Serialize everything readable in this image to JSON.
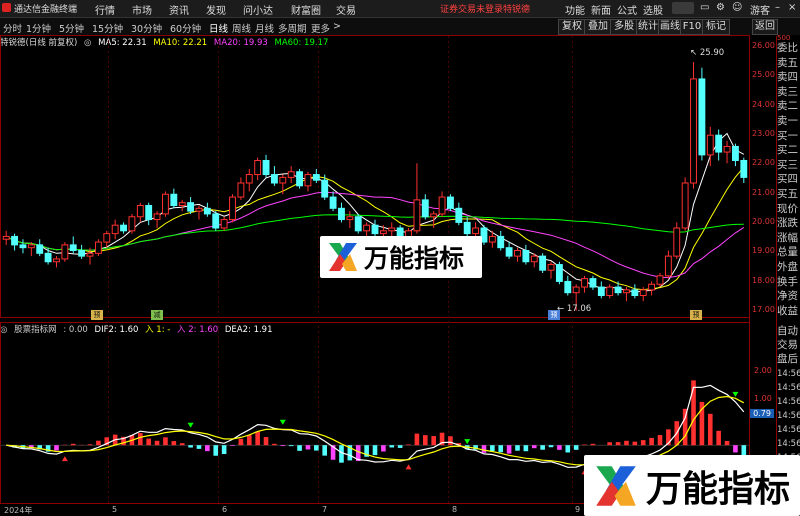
{
  "app": {
    "title": "通达信金融终端",
    "menu": [
      "行情",
      "市场",
      "资讯",
      "发现",
      "问小达",
      "财富圈",
      "交易"
    ],
    "login_status": "证券交易未登录",
    "stock_tag": "特锐德",
    "right_menu": [
      "功能",
      "新面",
      "公式",
      "选股"
    ],
    "user": "游客"
  },
  "toolbar": {
    "periods": [
      "分时",
      "1分钟",
      "5分钟",
      "15分钟",
      "30分钟",
      "60分钟",
      "日线",
      "周线",
      "月线",
      "多周期",
      "更多"
    ],
    "active_period": "日线",
    "buttons": [
      "复权",
      "叠加",
      "多股",
      "统计",
      "画线",
      "F10",
      "标记",
      "返回"
    ],
    "period_arrow": ">"
  },
  "main_chart": {
    "stock_label": "特锐德(日线 前复权)",
    "ma": [
      {
        "label": "MA5: 22.31",
        "color": "#ffffff"
      },
      {
        "label": "MA10: 22.21",
        "color": "#ffff00"
      },
      {
        "label": "MA20: 19.93",
        "color": "#ff44ff"
      },
      {
        "label": "MA60: 19.17",
        "color": "#00ff00"
      }
    ],
    "y_ticks": [
      "26.00",
      "25.00",
      "24.00",
      "23.00",
      "22.00",
      "21.00",
      "20.00",
      "19.00",
      "18.00",
      "17.00"
    ],
    "high_label": "25.90",
    "low_label": "17.06",
    "event_badges": [
      "预",
      "减",
      "预",
      "预"
    ]
  },
  "sub_chart": {
    "indicator_label": "股票指标网",
    "values": [
      {
        "label": ": 0.00",
        "color": "#cccccc"
      },
      {
        "label": "DIF2: 1.60",
        "color": "#ffffff"
      },
      {
        "label": "入 1: -",
        "color": "#ffff00"
      },
      {
        "label": "入 2: 1.60",
        "color": "#ff44ff"
      },
      {
        "label": "DEA2: 1.91",
        "color": "#ffffff"
      }
    ],
    "y_ticks": [
      "2.00",
      "1.00",
      "0.79"
    ]
  },
  "x_axis": [
    "2024年",
    "5",
    "6",
    "7",
    "8",
    "9"
  ],
  "right_panel": {
    "quote_labels": [
      "委比",
      "卖五",
      "卖四",
      "卖三",
      "卖二",
      "卖一",
      "买一",
      "买二",
      "买三",
      "买四",
      "买五",
      "现价",
      "涨跌",
      "涨幅",
      "总量",
      "外盘",
      "换手",
      "净资",
      "收益"
    ],
    "bottom_labels": [
      "自动",
      "交易",
      "盘后"
    ],
    "times": [
      "14:56",
      "14:56",
      "14:56",
      "14:56",
      "14:56",
      "14:56",
      "14:56"
    ],
    "top_value": "500"
  },
  "watermark": {
    "text": "万能指标"
  },
  "colors": {
    "up": "#ff3030",
    "down": "#54ffff",
    "ma5": "#ffffff",
    "ma10": "#ffff00",
    "ma20": "#ff44ff",
    "ma60": "#00ff00",
    "grid": "#8b0000",
    "watermark_bg": "#ffffff"
  },
  "chart_data": {
    "type": "candlestick",
    "ylim": [
      16.8,
      26.4
    ],
    "candles": [
      [
        19.6,
        19.9,
        19.4,
        19.7
      ],
      [
        19.7,
        19.8,
        19.2,
        19.4
      ],
      [
        19.4,
        19.6,
        19.1,
        19.3
      ],
      [
        19.3,
        19.5,
        19.0,
        19.4
      ],
      [
        19.4,
        19.6,
        19.0,
        19.1
      ],
      [
        19.1,
        19.3,
        18.7,
        18.8
      ],
      [
        18.8,
        19.0,
        18.6,
        18.9
      ],
      [
        18.9,
        19.5,
        18.8,
        19.4
      ],
      [
        19.4,
        19.7,
        19.1,
        19.2
      ],
      [
        19.2,
        19.4,
        18.9,
        19.0
      ],
      [
        19.0,
        19.3,
        18.7,
        19.1
      ],
      [
        19.1,
        19.6,
        19.0,
        19.5
      ],
      [
        19.5,
        19.9,
        19.3,
        19.8
      ],
      [
        19.8,
        20.3,
        19.6,
        20.1
      ],
      [
        20.1,
        20.2,
        19.8,
        19.9
      ],
      [
        19.9,
        20.5,
        19.8,
        20.4
      ],
      [
        20.4,
        20.9,
        20.2,
        20.8
      ],
      [
        20.8,
        20.9,
        20.1,
        20.3
      ],
      [
        20.3,
        20.6,
        20.0,
        20.5
      ],
      [
        20.5,
        21.3,
        20.4,
        21.2
      ],
      [
        21.2,
        21.4,
        20.7,
        20.8
      ],
      [
        20.8,
        21.0,
        20.6,
        20.9
      ],
      [
        20.9,
        21.1,
        20.5,
        20.6
      ],
      [
        20.6,
        20.8,
        20.3,
        20.7
      ],
      [
        20.7,
        20.9,
        20.4,
        20.5
      ],
      [
        20.5,
        20.6,
        19.9,
        20.0
      ],
      [
        20.0,
        20.4,
        19.9,
        20.3
      ],
      [
        20.3,
        21.2,
        20.2,
        21.1
      ],
      [
        21.1,
        21.8,
        21.0,
        21.6
      ],
      [
        21.6,
        22.1,
        21.3,
        21.9
      ],
      [
        21.9,
        22.5,
        21.7,
        22.4
      ],
      [
        22.4,
        22.6,
        21.8,
        21.9
      ],
      [
        21.9,
        22.2,
        21.5,
        21.6
      ],
      [
        21.6,
        21.9,
        21.2,
        21.8
      ],
      [
        21.8,
        22.2,
        21.6,
        22.0
      ],
      [
        22.0,
        22.1,
        21.4,
        21.5
      ],
      [
        21.5,
        22.0,
        21.3,
        21.9
      ],
      [
        21.9,
        22.1,
        21.6,
        21.7
      ],
      [
        21.7,
        21.9,
        21.0,
        21.1
      ],
      [
        21.1,
        21.3,
        20.6,
        20.7
      ],
      [
        20.7,
        20.9,
        20.2,
        20.3
      ],
      [
        20.3,
        20.6,
        20.0,
        20.4
      ],
      [
        20.4,
        20.5,
        19.8,
        19.9
      ],
      [
        19.9,
        20.2,
        19.6,
        20.1
      ],
      [
        20.1,
        20.3,
        19.7,
        19.8
      ],
      [
        19.8,
        20.1,
        19.5,
        19.9
      ],
      [
        19.9,
        20.2,
        19.7,
        20.0
      ],
      [
        20.0,
        20.1,
        19.5,
        19.6
      ],
      [
        19.6,
        20.0,
        19.5,
        19.9
      ],
      [
        19.9,
        22.3,
        19.8,
        21.0
      ],
      [
        21.0,
        21.2,
        20.3,
        20.4
      ],
      [
        20.4,
        20.6,
        20.0,
        20.5
      ],
      [
        20.5,
        21.3,
        20.4,
        21.1
      ],
      [
        21.1,
        21.2,
        20.6,
        20.7
      ],
      [
        20.7,
        20.9,
        20.1,
        20.2
      ],
      [
        20.2,
        20.4,
        19.7,
        19.8
      ],
      [
        19.8,
        20.2,
        19.6,
        20.0
      ],
      [
        20.0,
        20.1,
        19.4,
        19.5
      ],
      [
        19.5,
        19.9,
        19.3,
        19.7
      ],
      [
        19.7,
        19.9,
        19.2,
        19.3
      ],
      [
        19.3,
        19.5,
        18.9,
        19.0
      ],
      [
        19.0,
        19.3,
        18.8,
        19.2
      ],
      [
        19.2,
        19.4,
        18.7,
        18.8
      ],
      [
        18.8,
        19.1,
        18.6,
        19.0
      ],
      [
        19.0,
        19.1,
        18.4,
        18.5
      ],
      [
        18.5,
        18.8,
        18.2,
        18.7
      ],
      [
        18.7,
        18.8,
        18.0,
        18.1
      ],
      [
        18.1,
        18.3,
        17.6,
        17.7
      ],
      [
        17.7,
        18.0,
        17.06,
        17.9
      ],
      [
        17.9,
        18.3,
        17.7,
        18.2
      ],
      [
        18.2,
        18.3,
        17.8,
        17.9
      ],
      [
        17.9,
        18.1,
        17.5,
        17.6
      ],
      [
        17.6,
        18.0,
        17.5,
        17.9
      ],
      [
        17.9,
        18.1,
        17.6,
        17.7
      ],
      [
        17.7,
        17.9,
        17.4,
        17.8
      ],
      [
        17.8,
        18.0,
        17.5,
        17.6
      ],
      [
        17.6,
        17.9,
        17.4,
        17.8
      ],
      [
        17.8,
        18.1,
        17.6,
        18.0
      ],
      [
        18.0,
        18.4,
        17.9,
        18.3
      ],
      [
        18.3,
        19.2,
        18.2,
        19.0
      ],
      [
        19.0,
        20.2,
        18.9,
        20.0
      ],
      [
        20.0,
        21.8,
        19.9,
        21.6
      ],
      [
        21.6,
        25.9,
        21.4,
        25.3
      ],
      [
        25.3,
        25.7,
        22.4,
        22.6
      ],
      [
        22.6,
        23.6,
        22.2,
        23.3
      ],
      [
        23.3,
        23.5,
        22.4,
        22.7
      ],
      [
        22.7,
        23.1,
        22.3,
        22.9
      ],
      [
        22.9,
        23.0,
        22.2,
        22.4
      ],
      [
        22.4,
        22.5,
        21.6,
        21.8
      ]
    ]
  }
}
